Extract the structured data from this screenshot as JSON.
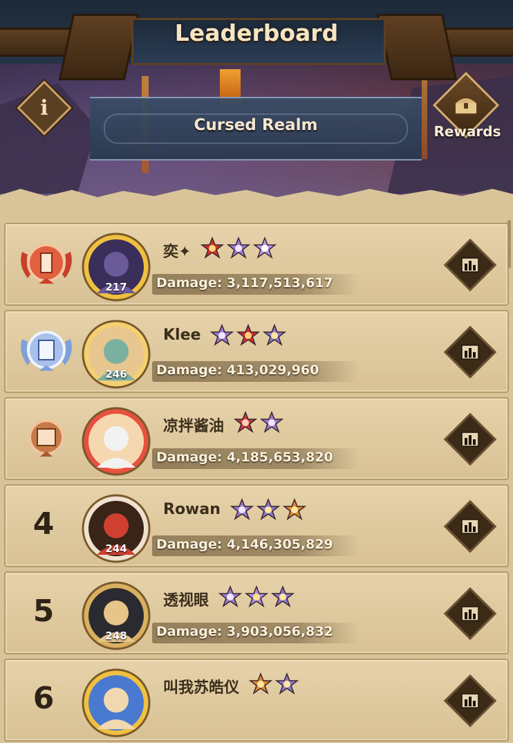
{
  "header": {
    "title": "Leaderboard",
    "realm": "Cursed Realm",
    "rewards_label": "Rewards",
    "info_icon": "i"
  },
  "colors": {
    "panel": "#d9c49a",
    "gold": "#e8c060",
    "text_dark": "#3b2e1c",
    "damage_text": "#fbf2dd"
  },
  "entries": [
    {
      "rank": "1",
      "rank_style": "medal-gold-red",
      "name": "奕✦",
      "level": "217",
      "damage": "Damage: 3,117,513,617",
      "emblems": [
        "red-star-emblem",
        "purple-star-emblem",
        "lavender-crest-emblem"
      ]
    },
    {
      "rank": "2",
      "rank_style": "medal-silver-blue",
      "name": "Klee",
      "level": "246",
      "damage": "Damage: 413,029,960",
      "emblems": [
        "purple-star-emblem",
        "red-star-emblem",
        "crossed-swords-emblem"
      ]
    },
    {
      "rank": "3",
      "rank_style": "medal-bronze",
      "name": "凉拌酱油",
      "level": "",
      "damage": "Damage: 4,185,653,820",
      "emblems": [
        "red-crest-emblem",
        "purple-star-emblem"
      ]
    },
    {
      "rank": "4",
      "rank_style": "number",
      "name": "Rowan",
      "level": "244",
      "damage": "Damage: 4,146,305,829",
      "emblems": [
        "purple-star-emblem",
        "crossed-swords-emblem",
        "flame-emblem"
      ]
    },
    {
      "rank": "5",
      "rank_style": "number",
      "name": "透视眼",
      "level": "248",
      "damage": "Damage: 3,903,056,832",
      "emblems": [
        "purple-star-emblem",
        "sun-star-emblem",
        "crossed-swords-emblem"
      ]
    },
    {
      "rank": "6",
      "rank_style": "number",
      "name": "叫我苏皓仪",
      "level": "",
      "damage": "",
      "emblems": [
        "flame-emblem",
        "crossed-swords-emblem"
      ]
    }
  ]
}
